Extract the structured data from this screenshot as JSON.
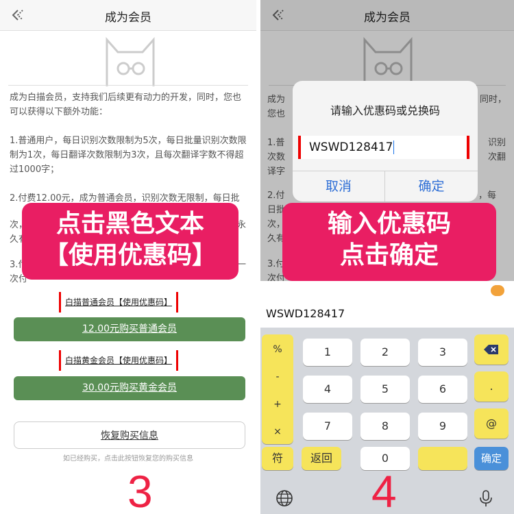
{
  "left": {
    "nav_title": "成为会员",
    "intro": "成为白描会员，支持我们后续更有动力的开发，同时，您也可以获得以下额外功能：",
    "item1": "1.普通用户，每日识别次数限制为5次，每日批量识别次数限制为1次，每日翻译次数限制为3次，且每次翻译字数不得超过1000字；",
    "item2_visible": "2.付费12.00元，成为普通会员，识别次数无限制，每日批",
    "item2_hidden_line": "次，",
    "item2_tail": "久有",
    "item2_right_tail": "永",
    "item3_start": "3.付",
    "item3_line2": "次付",
    "item3_right": "一",
    "overlay_line1": "点击黑色文本",
    "overlay_line2": "【使用优惠码】",
    "ordinary_code_link": "白描普通会员【使用优惠码】",
    "buy_ordinary": "12.00元购买普通会员",
    "gold_code_link": "白描黄金会员【使用优惠码】",
    "buy_gold": "30.00元购买黄金会员",
    "restore": "恢复购买信息",
    "restore_hint": "如已经购买，点击此按钮恢复您的购买信息",
    "step": "3"
  },
  "right": {
    "nav_title": "成为会员",
    "intro_frag1": "成为",
    "intro_frag1_right": "同时，",
    "intro_frag2": "您也",
    "item1_frag1": "1.普",
    "item1_frag1_right": "识别",
    "item1_frag2": "次数",
    "item1_frag2_right": "次翻",
    "item1_frag3": "译字",
    "item2_frag1": "2.付",
    "item2_frag1_right": "，每",
    "item2_frag2": "日批",
    "dialog_title": "请输入优惠码或兑换码",
    "dialog_value": "WSWD128417",
    "cancel": "取消",
    "ok": "确定",
    "overlay_line1": "输入优惠码",
    "overlay_line2": "点击确定",
    "behind1": "次，",
    "behind2": "久有",
    "behind3": "3.付",
    "behind4": "次付",
    "kb_preview": "WSWD128417",
    "sym_keys": [
      "%",
      "-",
      "+",
      "×"
    ],
    "num_keys": [
      "1",
      "2",
      "3",
      "4",
      "5",
      "6",
      "7",
      "8",
      "9"
    ],
    "right_keys": [
      ".",
      "@"
    ],
    "fu_key": "符",
    "back_key": "返回",
    "zero_key": "0",
    "confirm_key": "确定",
    "step": "4"
  },
  "colors": {
    "overlay": "#e91e63",
    "buy_button": "#5a8f55",
    "keyboard_yellow": "#f6e45a",
    "dialog_action": "#2f6fd6",
    "step_number": "#ee2244",
    "highlight_border": "#ee0000"
  }
}
